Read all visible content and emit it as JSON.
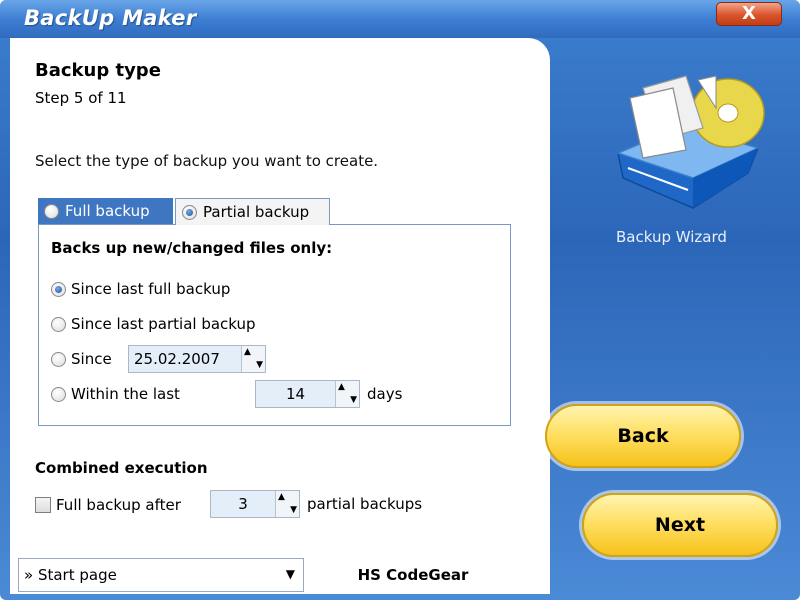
{
  "window": {
    "title": "BackUp Maker",
    "close_label": "X"
  },
  "page": {
    "heading": "Backup type",
    "step": "Step 5 of 11",
    "instruction": "Select the type of backup you want to create."
  },
  "tabs": [
    {
      "label": "Full backup",
      "selected": false
    },
    {
      "label": "Partial backup",
      "selected": true
    }
  ],
  "group": {
    "title": "Backs up new/changed files only:",
    "options": [
      {
        "label": "Since last full backup",
        "checked": true
      },
      {
        "label": "Since last partial backup",
        "checked": false
      },
      {
        "label": "Since",
        "checked": false,
        "date": "25.02.2007"
      },
      {
        "label": "Within the last",
        "checked": false,
        "days": "14",
        "suffix": "days"
      }
    ]
  },
  "combined": {
    "title": "Combined execution",
    "checkbox_label": "Full backup after",
    "checked": false,
    "count": "3",
    "suffix": "partial backups"
  },
  "footer": {
    "start_page": "» Start page",
    "company": "HS CodeGear"
  },
  "sidebar": {
    "wizard_label": "Backup Wizard"
  },
  "buttons": {
    "back": "Back",
    "next": "Next"
  },
  "colors": {
    "window_blue": "#2c66b8",
    "button_yellow": "#ffe064",
    "close_red": "#d9542b"
  },
  "icons": {
    "logo": "backup-drive-icon",
    "close": "close-icon",
    "spin": "spin-arrows-icon",
    "dropdown": "chevron-down-icon"
  }
}
